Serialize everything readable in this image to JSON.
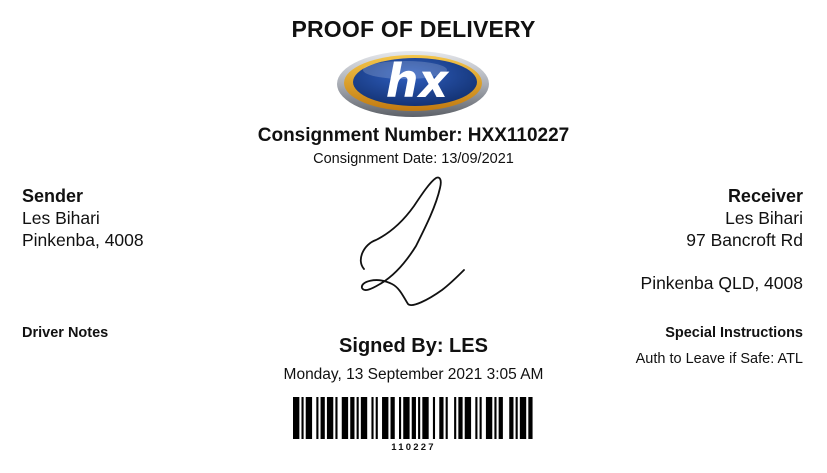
{
  "title": "PROOF OF DELIVERY",
  "logo": {
    "text": "hx",
    "colors": {
      "navy": "#1b3d8f",
      "gold": "#e0a020",
      "silver": "#b8bcc4"
    }
  },
  "consignment": {
    "number_label": "Consignment Number: HXX110227",
    "date_label": "Consignment Date: 13/09/2021"
  },
  "sender": {
    "heading": "Sender",
    "name": "Les Bihari",
    "location": "Pinkenba, 4008"
  },
  "receiver": {
    "heading": "Receiver",
    "name": "Les Bihari",
    "street": "97 Bancroft Rd",
    "location": "Pinkenba QLD, 4008"
  },
  "driver_notes": {
    "heading": "Driver Notes"
  },
  "special_instructions": {
    "heading": "Special Instructions",
    "text": "Auth to Leave if Safe: ATL"
  },
  "signature": {
    "signed_by": "Signed By: LES",
    "datetime": "Monday, 13 September 2021 3:05 AM"
  },
  "barcode": {
    "number": "110227"
  }
}
